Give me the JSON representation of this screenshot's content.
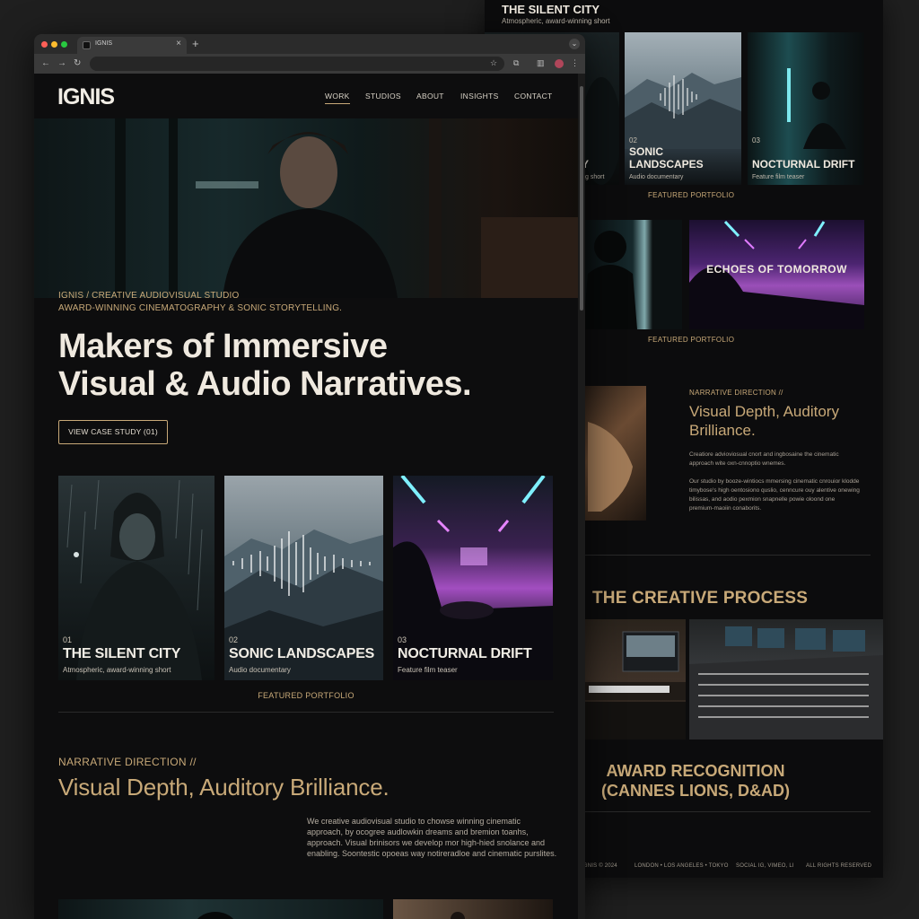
{
  "browser": {
    "tab_title": "IGNIS",
    "new_tab": "+",
    "tab_close": "×"
  },
  "site": {
    "logo": "IGNIS",
    "nav": [
      "WORK",
      "STUDIOS",
      "ABOUT",
      "INSIGHTS",
      "CONTACT"
    ],
    "hero": {
      "eyebrow_1": "IGNIS / CREATIVE AUDIOVISUAL STUDIO",
      "eyebrow_2": "AWARD-WINNING CINEMATOGRAPHY & SONIC STORYTELLING.",
      "headline_1": "Makers of Immersive",
      "headline_2": "Visual & Audio Narratives.",
      "cta": "VIEW CASE STUDY (01)"
    },
    "portfolio": [
      {
        "num": "01",
        "name": "THE SILENT CITY",
        "desc": "Atmospheric, award-winning short"
      },
      {
        "num": "02",
        "name": "SONIC LANDSCAPES",
        "desc": "Audio documentary"
      },
      {
        "num": "03",
        "name": "NOCTURNAL DRIFT",
        "desc": "Feature film teaser"
      }
    ],
    "featured_label": "FEATURED PORTFOLIO",
    "narrative": {
      "eyebrow": "NARRATIVE DIRECTION //",
      "headline": "Visual Depth, Auditory Brilliance.",
      "body": "We creative audiovisual studio to chowse winning cinematic approach, by ocogree audlowkin dreams and bremion toanhs, approach. Visual brinisors we develop mor high-hied snolance and enabling. Soontestic opoeas way notireradloe and cinematic purslites."
    }
  },
  "back_page": {
    "title": "THE SILENT CITY",
    "subtitle": "Atmospheric, award-winning short",
    "partial_card_name": "Y",
    "partial_card_desc": "g short",
    "cards": [
      {
        "num": "02",
        "name": "SONIC LANDSCAPES",
        "desc": "Audio documentary"
      },
      {
        "num": "03",
        "name": "NOCTURNAL DRIFT",
        "desc": "Feature film teaser"
      }
    ],
    "featured_label": "FEATURED PORTFOLIO",
    "echoes_title": "ECHOES OF TOMORROW",
    "narrative_eyebrow": "NARRATIVE DIRECTION //",
    "narrative_headline": "Visual Depth, Auditory Brilliance.",
    "narrative_p1": "Creatiore advioviosual cnort and ingbosaine the cinematic approach wite oxn-cnnoptio wnemes.",
    "narrative_p2": "Our studio by booze-wintiocs mmersing cinematic cnrouior klodde timybose's high oentosiono quslio, cenncure ouy alentive onewing bilissas, and aodio pexmion snapnelle powie oloond one premium-maoiin conaborits.",
    "process_title": "THE CREATIVE PROCESS",
    "award": "AWARD RECOGNITION (CANNES LIONS, D&AD)",
    "footer": [
      "IGNIS © 2024",
      "LONDON • LOS ANGELES • TOKYO",
      "SOCIAL IG, VIMEO, LI",
      "ALL RIGHTS RESERVED"
    ]
  },
  "colors": {
    "accent_gold": "#c8a978",
    "page_bg": "#0d0d0e",
    "text_light": "#efe9df"
  }
}
